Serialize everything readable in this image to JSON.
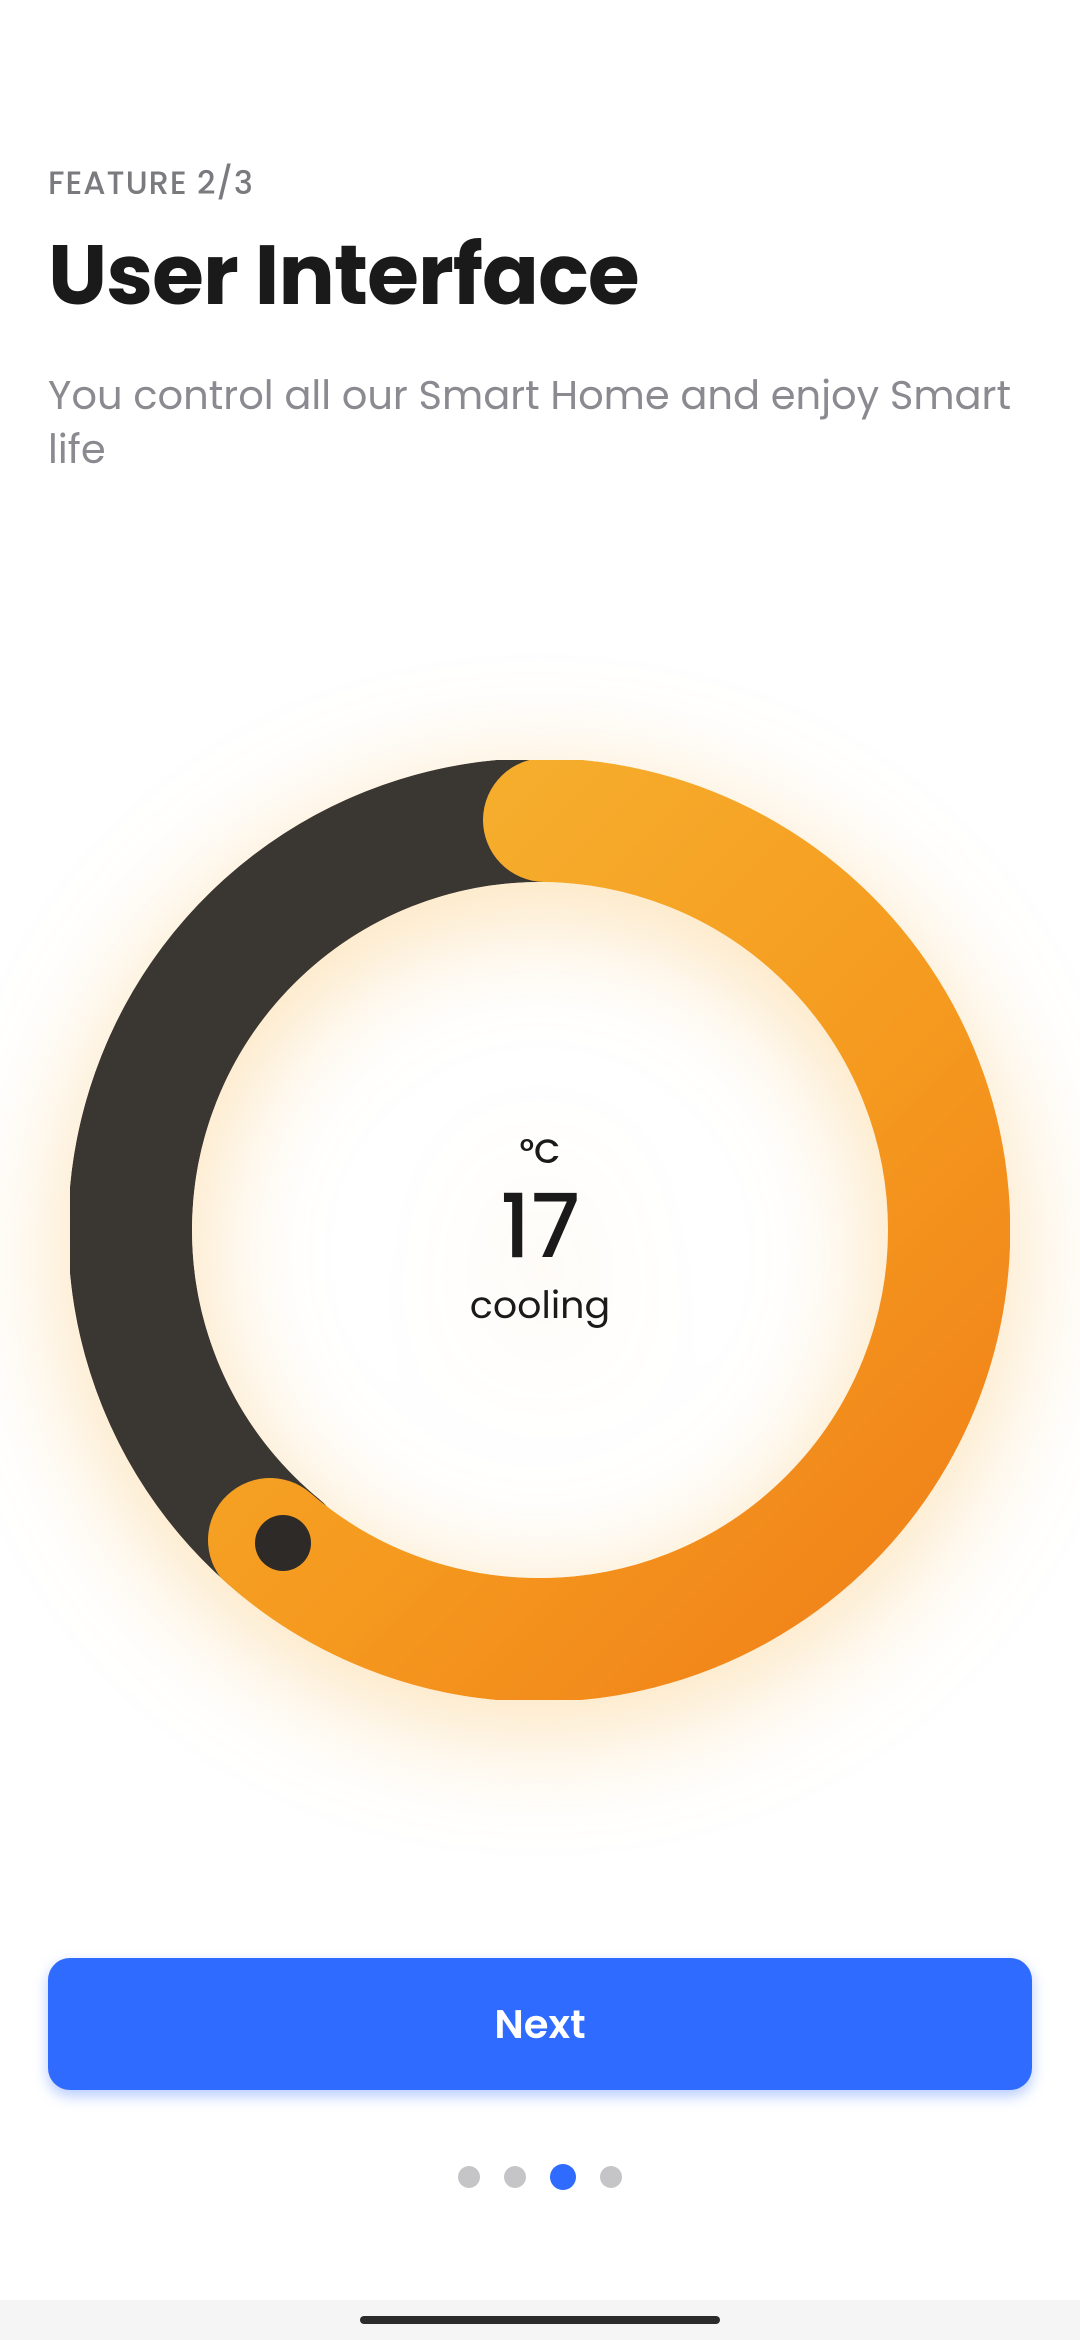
{
  "header": {
    "badge": "FEATURE 2/3",
    "title": "User Interface",
    "subtitle": "You control all our Smart Home and enjoy Smart life"
  },
  "dial": {
    "unit": "°C",
    "value": "17",
    "mode": "cooling"
  },
  "footer": {
    "next": "Next"
  },
  "pager": {
    "count": 4,
    "active": 2
  }
}
